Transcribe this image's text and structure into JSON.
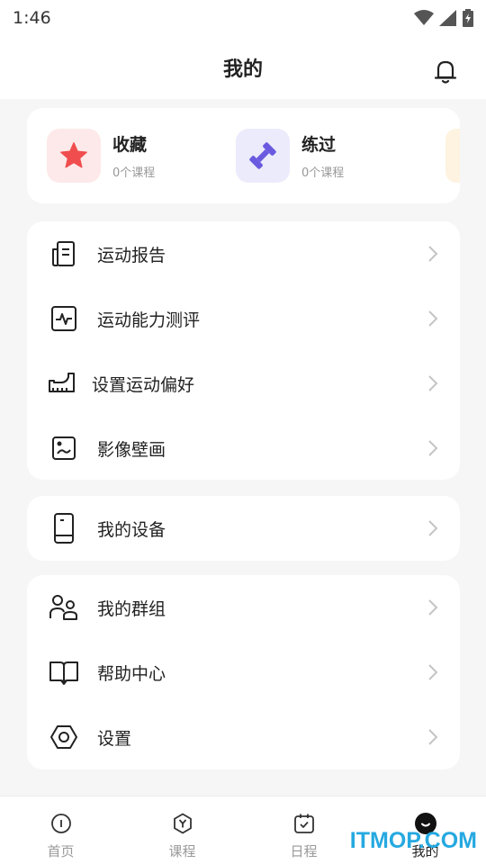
{
  "status": {
    "time": "1:46"
  },
  "header": {
    "title": "我的"
  },
  "favorites": [
    {
      "title": "收藏",
      "subtitle": "0个课程",
      "icon": "star-icon",
      "bg": "#fde9e9",
      "color": "#f04e4e"
    },
    {
      "title": "练过",
      "subtitle": "0个课程",
      "icon": "dumbbell-icon",
      "bg": "#ecebfb",
      "color": "#6a5ae0"
    }
  ],
  "menu_group_1": [
    {
      "label": "运动报告",
      "icon": "report-icon"
    },
    {
      "label": "运动能力测评",
      "icon": "pulse-icon"
    },
    {
      "label": "设置运动偏好",
      "icon": "shoe-icon"
    },
    {
      "label": "影像壁画",
      "icon": "picture-icon"
    }
  ],
  "menu_group_2": [
    {
      "label": "我的设备",
      "icon": "device-icon"
    }
  ],
  "menu_group_3": [
    {
      "label": "我的群组",
      "icon": "group-icon"
    },
    {
      "label": "帮助中心",
      "icon": "book-icon"
    },
    {
      "label": "设置",
      "icon": "settings-icon"
    }
  ],
  "tabs": [
    {
      "label": "首页",
      "icon": "home-icon"
    },
    {
      "label": "课程",
      "icon": "course-icon"
    },
    {
      "label": "日程",
      "icon": "calendar-icon"
    },
    {
      "label": "我的",
      "icon": "profile-icon",
      "active": true
    }
  ],
  "watermark": "ITMOP.COM",
  "colors": {
    "accent": "#222222",
    "inactive": "#999999",
    "watermark": "#26a9e0"
  }
}
